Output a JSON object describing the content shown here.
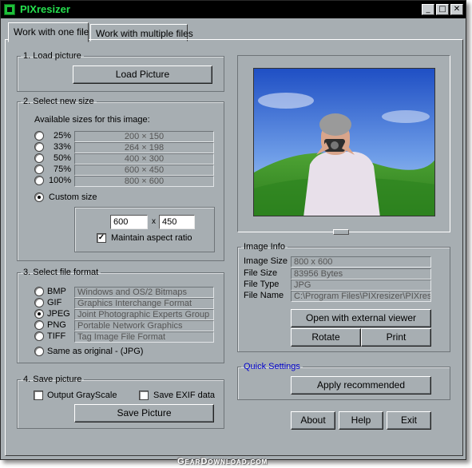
{
  "window": {
    "title": "PIXresizer"
  },
  "titlebar": {
    "minimize_glyph": "_",
    "maximize_glyph": "□",
    "close_glyph": "✕"
  },
  "tabs": [
    {
      "label": "Work with one file",
      "active": true
    },
    {
      "label": "Work with multiple files",
      "active": false
    }
  ],
  "load_section": {
    "legend": "1. Load picture",
    "button_label": "Load Picture"
  },
  "size_section": {
    "legend": "2. Select new size",
    "available_label": "Available sizes for this image:",
    "options": [
      {
        "percent": "25%",
        "dims": "200 × 150"
      },
      {
        "percent": "33%",
        "dims": "264 × 198"
      },
      {
        "percent": "50%",
        "dims": "400 × 300"
      },
      {
        "percent": "75%",
        "dims": "600 × 450"
      },
      {
        "percent": "100%",
        "dims": "800 × 600"
      }
    ],
    "custom_label": "Custom size",
    "custom_selected": true,
    "width_value": "600",
    "times_glyph": "x",
    "height_value": "450",
    "maintain_aspect_label": "Maintain aspect ratio",
    "maintain_aspect_checked": true
  },
  "format_section": {
    "legend": "3. Select file format",
    "options": [
      {
        "name": "BMP",
        "desc": "Windows and OS/2 Bitmaps"
      },
      {
        "name": "GIF",
        "desc": "Graphics Interchange Format"
      },
      {
        "name": "JPEG",
        "desc": "Joint Photographic Experts Group",
        "selected": true
      },
      {
        "name": "PNG",
        "desc": "Portable Network Graphics"
      },
      {
        "name": "TIFF",
        "desc": "Tag Image File Format"
      }
    ],
    "same_as_original_label": "Same as original  - (JPG)"
  },
  "save_section": {
    "legend": "4. Save picture",
    "grayscale_label": "Output GrayScale",
    "exif_label": "Save EXIF data",
    "button_label": "Save Picture"
  },
  "image_info": {
    "legend": "Image Info",
    "rows": [
      {
        "label": "Image Size",
        "value": "800 x 600"
      },
      {
        "label": "File Size",
        "value": "83956 Bytes"
      },
      {
        "label": "File Type",
        "value": "JPG"
      },
      {
        "label": "File Name",
        "value": "C:\\Program Files\\PIXresizer\\PIXresizer"
      }
    ],
    "open_viewer_label": "Open with external viewer",
    "rotate_label": "Rotate",
    "print_label": "Print"
  },
  "quick_settings": {
    "legend": "Quick Settings",
    "legend_color": "#0000cc",
    "apply_label": "Apply recommended"
  },
  "footer": {
    "about_label": "About",
    "help_label": "Help",
    "exit_label": "Exit"
  },
  "watermark": "GearDownload.com",
  "colors": {
    "title_bg": "#000000",
    "title_fg": "#25e04e",
    "face": "#a7aeb2"
  }
}
